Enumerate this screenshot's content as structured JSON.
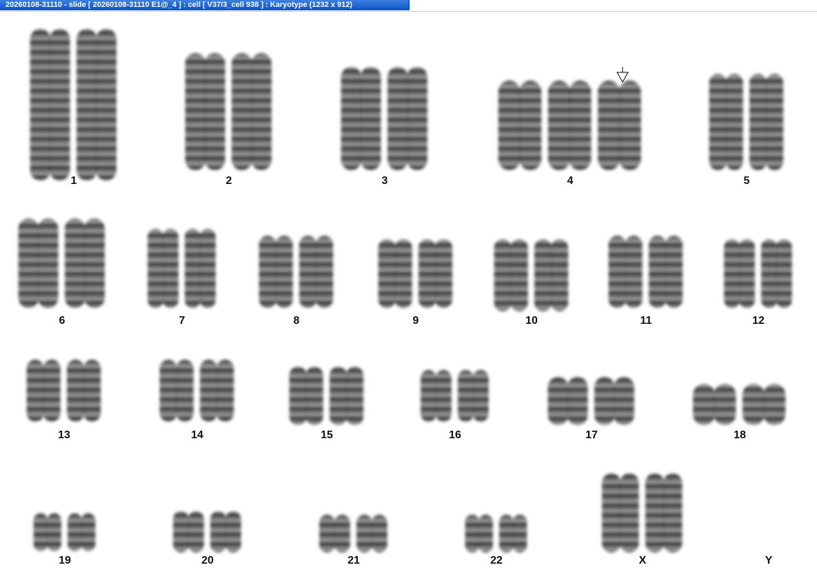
{
  "window": {
    "title": "20260108-31110 - slide [ 20260108-31110 E1@_4 ] : cell [ V37/3_cell 938 ] : Karyotype  (1232 x 912)"
  },
  "karyotype": {
    "pointer_icon": "down-arrow-marker",
    "chromosomes": [
      {
        "label": "1"
      },
      {
        "label": "2"
      },
      {
        "label": "3"
      },
      {
        "label": "4"
      },
      {
        "label": "5"
      },
      {
        "label": "6"
      },
      {
        "label": "7"
      },
      {
        "label": "8"
      },
      {
        "label": "9"
      },
      {
        "label": "10"
      },
      {
        "label": "11"
      },
      {
        "label": "12"
      },
      {
        "label": "13"
      },
      {
        "label": "14"
      },
      {
        "label": "15"
      },
      {
        "label": "16"
      },
      {
        "label": "17"
      },
      {
        "label": "18"
      },
      {
        "label": "19"
      },
      {
        "label": "20"
      },
      {
        "label": "21"
      },
      {
        "label": "22"
      },
      {
        "label": "X"
      },
      {
        "label": "Y"
      }
    ]
  },
  "colors": {
    "titlebar_active": "#0a54c8",
    "chromosome": "#3a3a3a"
  }
}
